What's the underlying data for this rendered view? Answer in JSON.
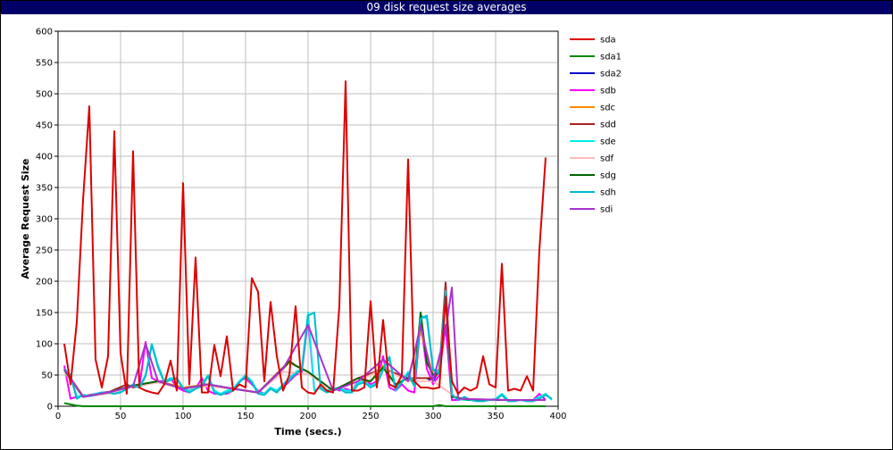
{
  "chart_data": {
    "type": "line",
    "title": "09 disk request size averages",
    "xlabel": "Time (secs.)",
    "ylabel": "Average Request Size",
    "xlim": [
      0,
      400
    ],
    "ylim": [
      0,
      600
    ],
    "xticks": [
      0,
      50,
      100,
      150,
      200,
      250,
      300,
      350,
      400
    ],
    "yticks": [
      0,
      50,
      100,
      150,
      200,
      250,
      300,
      350,
      400,
      450,
      500,
      550,
      600
    ],
    "grid": true,
    "legend_position": "right",
    "series": [
      {
        "name": "sda",
        "color": "#dd0000",
        "x": [
          5,
          10,
          15,
          20,
          25,
          30,
          35,
          40,
          45,
          50,
          55,
          60,
          65,
          70,
          75,
          80,
          85,
          90,
          95,
          100,
          105,
          110,
          115,
          120,
          125,
          130,
          135,
          140,
          145,
          150,
          155,
          160,
          165,
          170,
          175,
          180,
          185,
          190,
          195,
          200,
          205,
          210,
          215,
          220,
          225,
          230,
          235,
          240,
          245,
          250,
          255,
          260,
          265,
          270,
          275,
          280,
          285,
          290,
          295,
          300,
          305,
          310,
          315,
          320,
          325,
          330,
          335,
          340,
          345,
          350,
          355,
          360,
          365,
          370,
          375,
          380,
          385,
          390
        ],
        "y": [
          100,
          35,
          135,
          330,
          480,
          75,
          30,
          80,
          440,
          85,
          20,
          408,
          30,
          25,
          22,
          20,
          35,
          73,
          25,
          357,
          35,
          238,
          22,
          22,
          98,
          48,
          112,
          25,
          35,
          30,
          205,
          183,
          40,
          167,
          80,
          25,
          50,
          160,
          30,
          22,
          20,
          35,
          25,
          22,
          160,
          520,
          25,
          25,
          30,
          168,
          30,
          138,
          35,
          30,
          50,
          395,
          40,
          30,
          30,
          28,
          30,
          175,
          40,
          20,
          30,
          25,
          30,
          80,
          35,
          30,
          228,
          25,
          28,
          25,
          48,
          25,
          250,
          398
        ]
      },
      {
        "name": "sda1",
        "color": "#008800",
        "x": [
          5,
          10,
          15,
          20,
          50,
          100,
          150,
          200,
          250,
          300,
          305,
          310,
          315,
          320,
          350,
          390
        ],
        "y": [
          5,
          3,
          1,
          0,
          0,
          0,
          0,
          0,
          0,
          0,
          2,
          0,
          0,
          0,
          0,
          0
        ]
      },
      {
        "name": "sda2",
        "color": "#0000cc",
        "x": [
          295,
          300,
          305,
          310,
          315
        ],
        "y": [
          45,
          40,
          60,
          178,
          20
        ]
      },
      {
        "name": "sdb",
        "color": "#ff00ff",
        "x": [
          5,
          10,
          15,
          20,
          25,
          30,
          35,
          40,
          45,
          50,
          55,
          60,
          65,
          70,
          75,
          80,
          85,
          90,
          95,
          100,
          105,
          110,
          115,
          120,
          125,
          130,
          135,
          140,
          145,
          150,
          155,
          160,
          165,
          170,
          175,
          180,
          185,
          190,
          195,
          200,
          205,
          210,
          215,
          220,
          225,
          230,
          235,
          240,
          245,
          250,
          255,
          260,
          265,
          270,
          275,
          280,
          285,
          290,
          295,
          300,
          305,
          310,
          315,
          320,
          325,
          330,
          335,
          340,
          345,
          350,
          355,
          360,
          365,
          370,
          375,
          380,
          385,
          390
        ],
        "y": [
          65,
          12,
          15,
          16,
          18,
          20,
          22,
          23,
          22,
          25,
          30,
          35,
          30,
          103,
          45,
          40,
          40,
          45,
          30,
          25,
          22,
          28,
          45,
          25,
          20,
          20,
          20,
          25,
          40,
          45,
          35,
          25,
          20,
          30,
          25,
          30,
          40,
          50,
          55,
          140,
          25,
          30,
          25,
          30,
          25,
          28,
          25,
          40,
          45,
          35,
          40,
          80,
          30,
          25,
          35,
          25,
          22,
          135,
          60,
          35,
          50,
          130,
          10,
          10,
          12,
          10,
          10,
          10,
          10,
          10,
          10,
          10,
          10,
          10,
          10,
          10,
          20,
          10
        ]
      },
      {
        "name": "sdc",
        "color": "#ff8800",
        "x": [
          5,
          20,
          40,
          60,
          80,
          100,
          120,
          140,
          160,
          180,
          185,
          190,
          195,
          200,
          220,
          240,
          245,
          250,
          260,
          270,
          280,
          290,
          300,
          305,
          310,
          315,
          330,
          360,
          390
        ],
        "y": [
          60,
          16,
          22,
          32,
          40,
          30,
          35,
          28,
          22,
          60,
          70,
          65,
          60,
          55,
          25,
          45,
          40,
          40,
          65,
          35,
          45,
          120,
          50,
          60,
          190,
          15,
          10,
          10,
          10
        ]
      },
      {
        "name": "sdd",
        "color": "#aa2222",
        "x": [
          5,
          20,
          40,
          55,
          60,
          80,
          100,
          120,
          140,
          160,
          180,
          185,
          190,
          200,
          220,
          240,
          260,
          280,
          300,
          305,
          310,
          315,
          330,
          360,
          390
        ],
        "y": [
          58,
          16,
          22,
          35,
          30,
          40,
          28,
          35,
          28,
          22,
          62,
          72,
          65,
          55,
          25,
          45,
          60,
          45,
          45,
          55,
          198,
          15,
          10,
          10,
          10
        ]
      },
      {
        "name": "sde",
        "color": "#00eeee",
        "x": [
          5,
          10,
          15,
          20,
          25,
          30,
          35,
          40,
          45,
          50,
          55,
          60,
          65,
          70,
          75,
          80,
          85,
          90,
          95,
          100,
          105,
          110,
          115,
          120,
          125,
          130,
          135,
          140,
          145,
          150,
          155,
          160,
          165,
          170,
          175,
          180,
          185,
          190,
          195,
          200,
          205,
          210,
          215,
          220,
          225,
          230,
          235,
          240,
          245,
          250,
          255,
          260,
          265,
          270,
          275,
          280,
          285,
          290,
          295,
          300,
          305,
          310,
          315,
          320,
          325,
          330,
          335,
          340,
          345,
          350,
          355,
          360,
          365,
          370,
          375,
          380,
          385,
          390,
          395
        ],
        "y": [
          60,
          50,
          15,
          18,
          17,
          20,
          22,
          22,
          20,
          24,
          30,
          35,
          30,
          50,
          100,
          65,
          40,
          45,
          45,
          30,
          25,
          30,
          35,
          50,
          25,
          20,
          25,
          28,
          40,
          50,
          40,
          22,
          20,
          30,
          25,
          35,
          45,
          55,
          60,
          150,
          25,
          30,
          25,
          28,
          30,
          25,
          25,
          38,
          40,
          32,
          38,
          60,
          80,
          28,
          40,
          55,
          35,
          145,
          140,
          60,
          55,
          180,
          20,
          12,
          10,
          10,
          10,
          10,
          10,
          12,
          20,
          10,
          10,
          10,
          10,
          10,
          15,
          20,
          10
        ]
      },
      {
        "name": "sdf",
        "color": "#ffbbbb",
        "x": [
          5,
          20,
          40,
          60,
          80,
          100,
          120,
          140,
          160,
          180,
          200,
          220,
          240,
          260,
          280,
          300,
          320,
          360,
          390
        ],
        "y": [
          55,
          15,
          20,
          32,
          38,
          28,
          32,
          28,
          22,
          55,
          52,
          25,
          40,
          60,
          40,
          40,
          12,
          10,
          10
        ]
      },
      {
        "name": "sdg",
        "color": "#006600",
        "x": [
          5,
          20,
          40,
          60,
          80,
          100,
          120,
          140,
          160,
          180,
          185,
          190,
          200,
          220,
          240,
          245,
          250,
          260,
          270,
          280,
          285,
          290,
          295,
          300,
          305,
          310,
          315,
          330,
          360,
          390
        ],
        "y": [
          58,
          15,
          22,
          33,
          40,
          28,
          35,
          28,
          22,
          60,
          72,
          65,
          55,
          25,
          45,
          42,
          40,
          62,
          35,
          45,
          40,
          150,
          70,
          50,
          55,
          175,
          15,
          10,
          10,
          10
        ]
      },
      {
        "name": "sdh",
        "color": "#00bbcc",
        "x": [
          5,
          10,
          15,
          20,
          25,
          30,
          35,
          40,
          45,
          50,
          55,
          60,
          65,
          70,
          75,
          80,
          85,
          90,
          95,
          100,
          105,
          110,
          115,
          120,
          125,
          130,
          135,
          140,
          145,
          150,
          155,
          160,
          165,
          170,
          175,
          180,
          185,
          190,
          195,
          200,
          205,
          210,
          215,
          220,
          225,
          230,
          235,
          240,
          245,
          250,
          255,
          260,
          265,
          270,
          275,
          280,
          285,
          290,
          295,
          300,
          305,
          310,
          315,
          320,
          325,
          330,
          335,
          340,
          345,
          350,
          355,
          360,
          365,
          370,
          375,
          380,
          385,
          390,
          395
        ],
        "y": [
          58,
          48,
          12,
          18,
          16,
          18,
          22,
          22,
          20,
          22,
          28,
          33,
          30,
          48,
          98,
          62,
          38,
          42,
          44,
          28,
          22,
          28,
          32,
          48,
          22,
          18,
          22,
          25,
          38,
          48,
          38,
          20,
          18,
          28,
          22,
          33,
          42,
          52,
          58,
          145,
          150,
          28,
          22,
          25,
          28,
          22,
          22,
          35,
          38,
          30,
          35,
          58,
          78,
          25,
          38,
          52,
          32,
          140,
          145,
          58,
          52,
          185,
          18,
          10,
          15,
          10,
          8,
          8,
          10,
          10,
          18,
          8,
          8,
          10,
          8,
          8,
          12,
          18,
          12
        ]
      },
      {
        "name": "sdi",
        "color": "#aa33cc",
        "x": [
          5,
          20,
          40,
          60,
          70,
          80,
          100,
          120,
          140,
          160,
          180,
          200,
          220,
          240,
          260,
          280,
          290,
          300,
          310,
          315,
          320,
          360,
          390
        ],
        "y": [
          60,
          15,
          22,
          32,
          100,
          40,
          28,
          35,
          28,
          22,
          60,
          130,
          25,
          40,
          75,
          40,
          130,
          40,
          120,
          190,
          12,
          10,
          10
        ]
      }
    ]
  }
}
